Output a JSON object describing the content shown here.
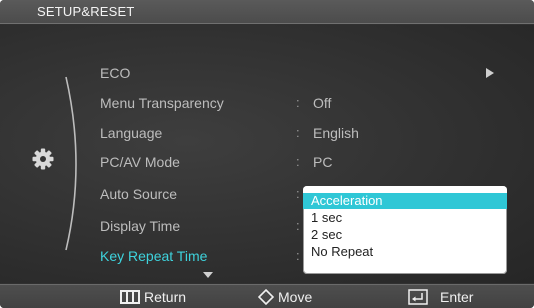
{
  "header": {
    "title": "SETUP&RESET"
  },
  "menu": {
    "items": [
      {
        "label": "ECO",
        "value": "",
        "has_submenu": true
      },
      {
        "label": "Menu Transparency",
        "value": "Off"
      },
      {
        "label": "Language",
        "value": "English"
      },
      {
        "label": "PC/AV Mode",
        "value": "PC"
      },
      {
        "label": "Auto Source",
        "value": ""
      },
      {
        "label": "Display Time",
        "value": ""
      },
      {
        "label": "Key Repeat Time",
        "value": "",
        "selected": true
      }
    ],
    "separator": ":",
    "section_icon": "gear-icon",
    "more_indicator": "chevron-down-icon"
  },
  "dropdown": {
    "options": [
      "Acceleration",
      "1 sec",
      "2 sec",
      "No Repeat"
    ],
    "selected_index": 0
  },
  "footer": {
    "return_label": "Return",
    "move_label": "Move",
    "enter_label": "Enter",
    "return_icon": "menu-icon",
    "move_icon": "diamond-nav-icon",
    "enter_icon": "enter-icon"
  },
  "colors": {
    "accent": "#3ed3dd",
    "highlight": "#2fc7d6",
    "background": "#303030",
    "text": "#bdbdbd"
  }
}
